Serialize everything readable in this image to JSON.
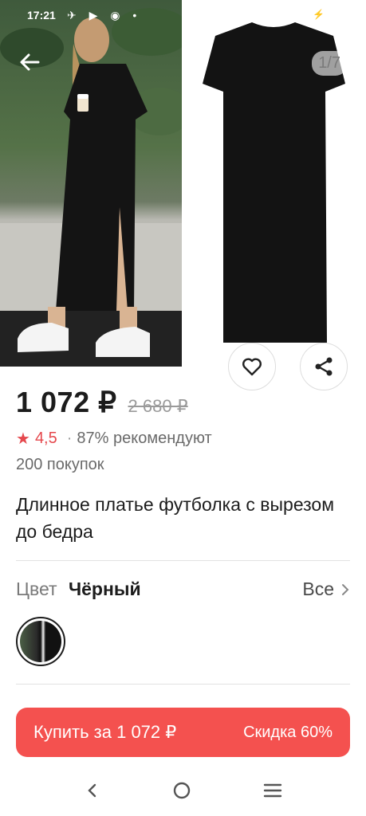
{
  "status_bar": {
    "time": "17:21"
  },
  "gallery": {
    "counter": "1/7"
  },
  "product": {
    "price": "1 072 ₽",
    "old_price": "2 680 ₽",
    "rating": "4,5",
    "recommend": "87% рекомендуют",
    "purchases": "200 покупок",
    "title": "Длинное платье футболка с вырезом до бедра"
  },
  "color_section": {
    "label": "Цвет",
    "value": "Чёрный",
    "all_link": "Все"
  },
  "buy_button": {
    "label": "Купить за 1 072 ₽",
    "discount": "Скидка 60%"
  },
  "colors": {
    "accent": "#f4514f",
    "star": "#e5484d"
  }
}
